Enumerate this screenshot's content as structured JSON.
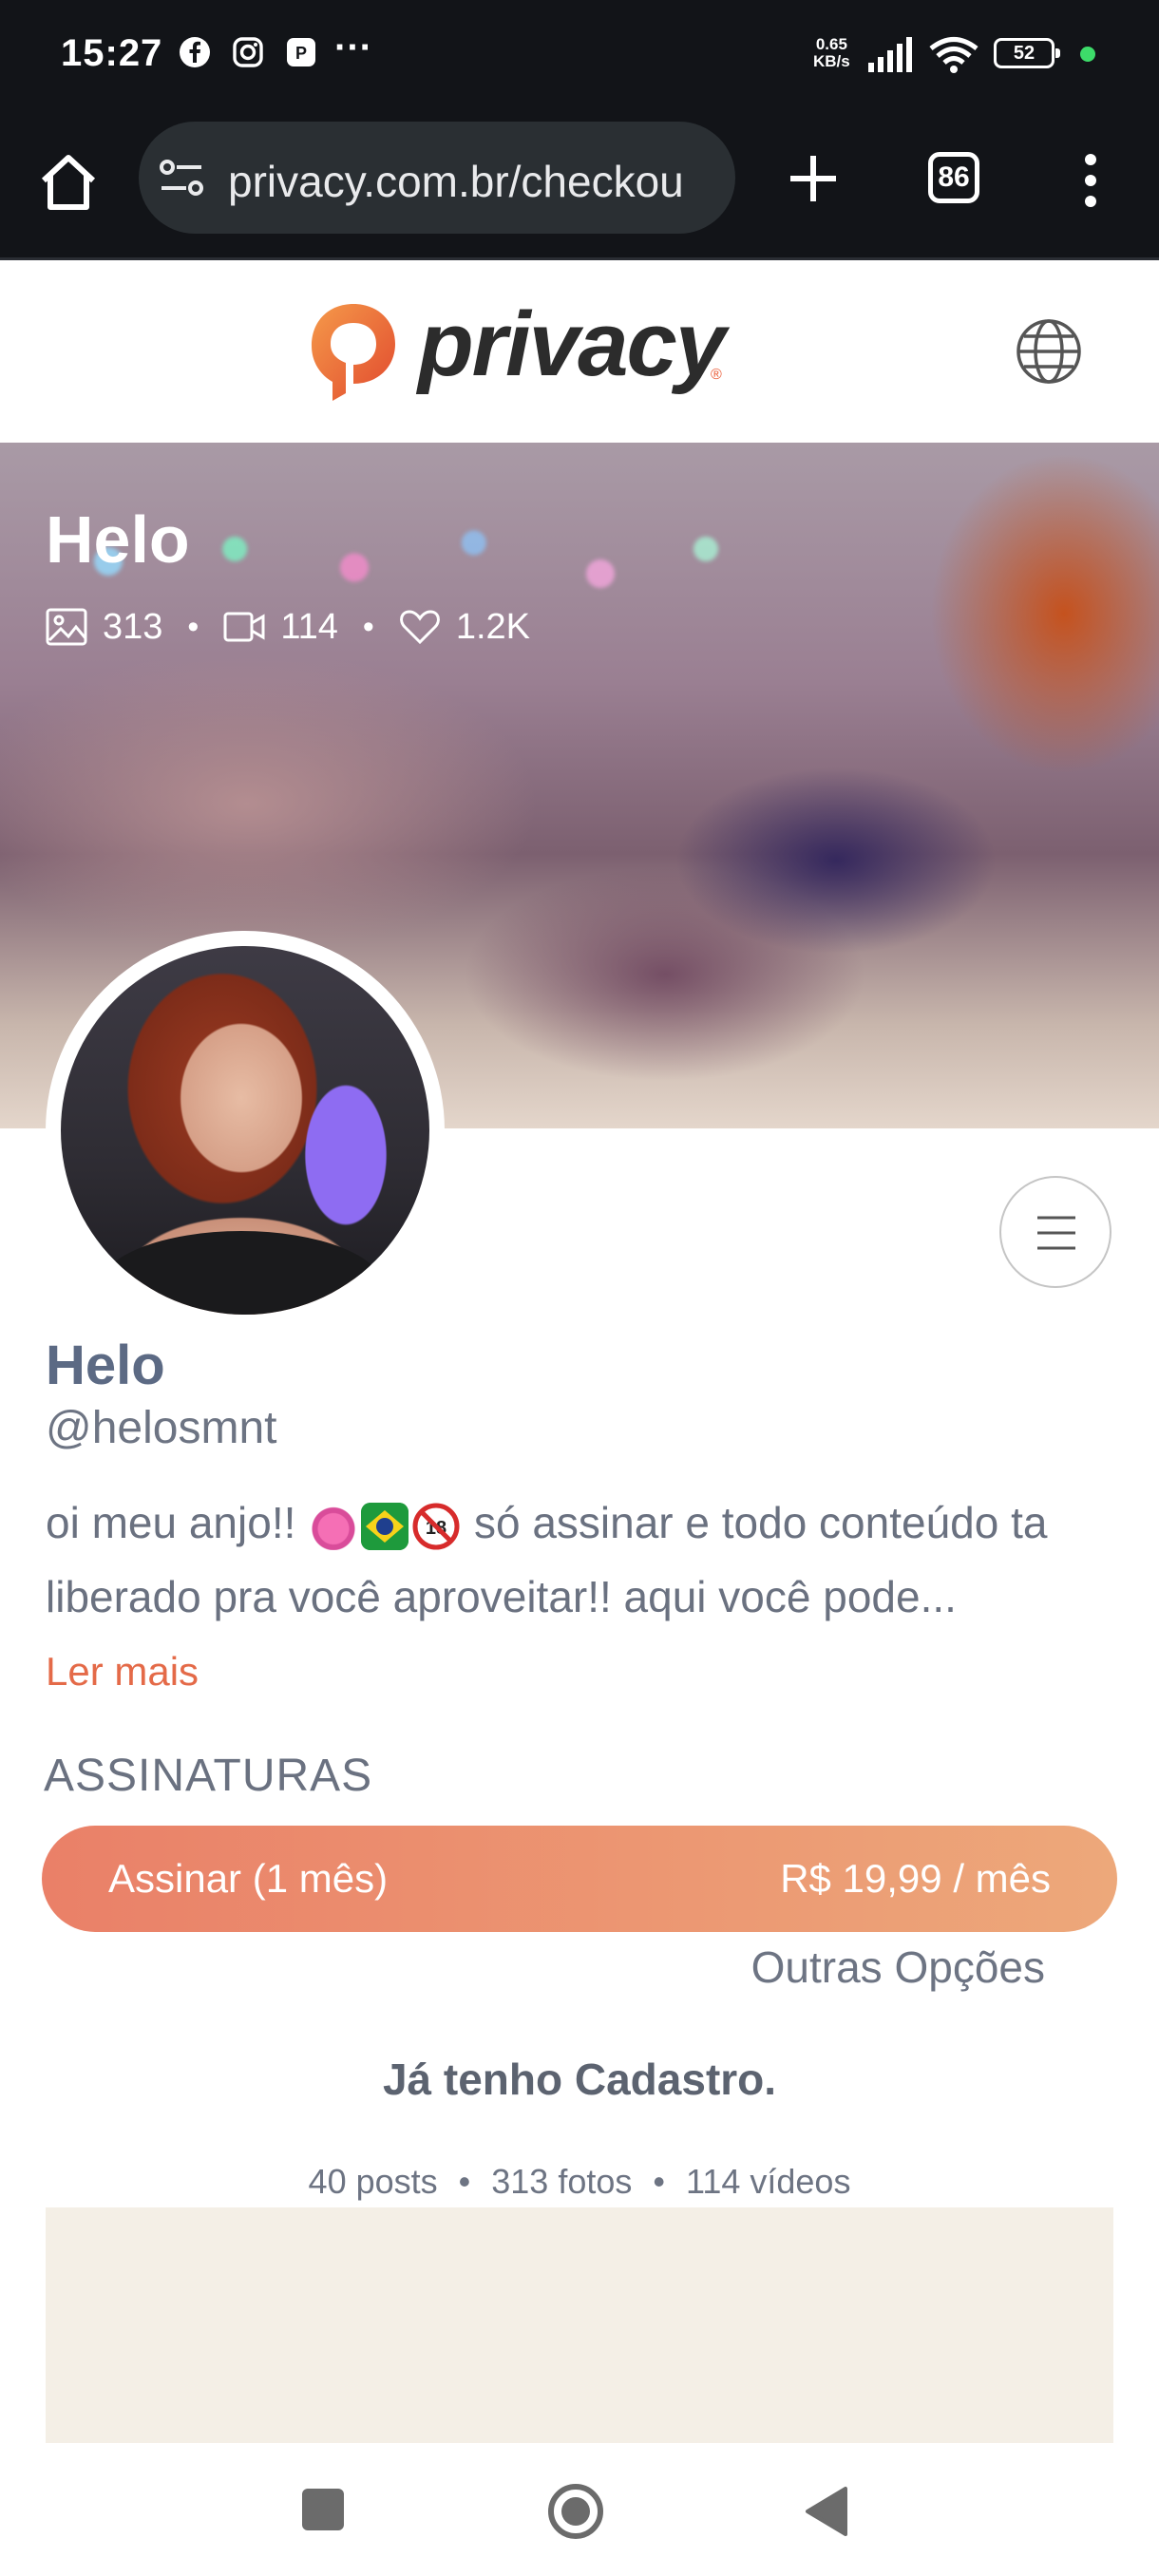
{
  "status_bar": {
    "time": "15:27",
    "network_speed_value": "0.65",
    "network_speed_unit": "KB/s",
    "battery": "52",
    "icons": [
      "facebook-icon",
      "instagram-icon",
      "app-icon",
      "more-dots",
      "signal-icon",
      "wifi-icon",
      "battery-icon"
    ]
  },
  "browser": {
    "url": "privacy.com.br/checkou",
    "tab_count": "86"
  },
  "site": {
    "logo_text": "privacy",
    "logo_reg": "®",
    "brand_color": "#ea5b36"
  },
  "cover": {
    "title": "Helo",
    "photos": "313",
    "videos": "114",
    "likes": "1.2K"
  },
  "profile": {
    "name": "Helo",
    "handle": "@helosmnt",
    "bio_part1": "oi meu anjo!! ",
    "bio_part2": " só assinar e todo conteúdo ta liberado pra você aproveitar!! aqui você pode...",
    "read_more": "Ler mais"
  },
  "subscriptions": {
    "title": "ASSINATURAS",
    "button_label": "Assinar (1 mês)",
    "button_price": "R$ 19,99 / mês",
    "other_options": "Outras Opções"
  },
  "login_text": "Já tenho Cadastro.",
  "counts": {
    "posts": "40 posts",
    "photos": "313 fotos",
    "videos": "114 vídeos"
  }
}
